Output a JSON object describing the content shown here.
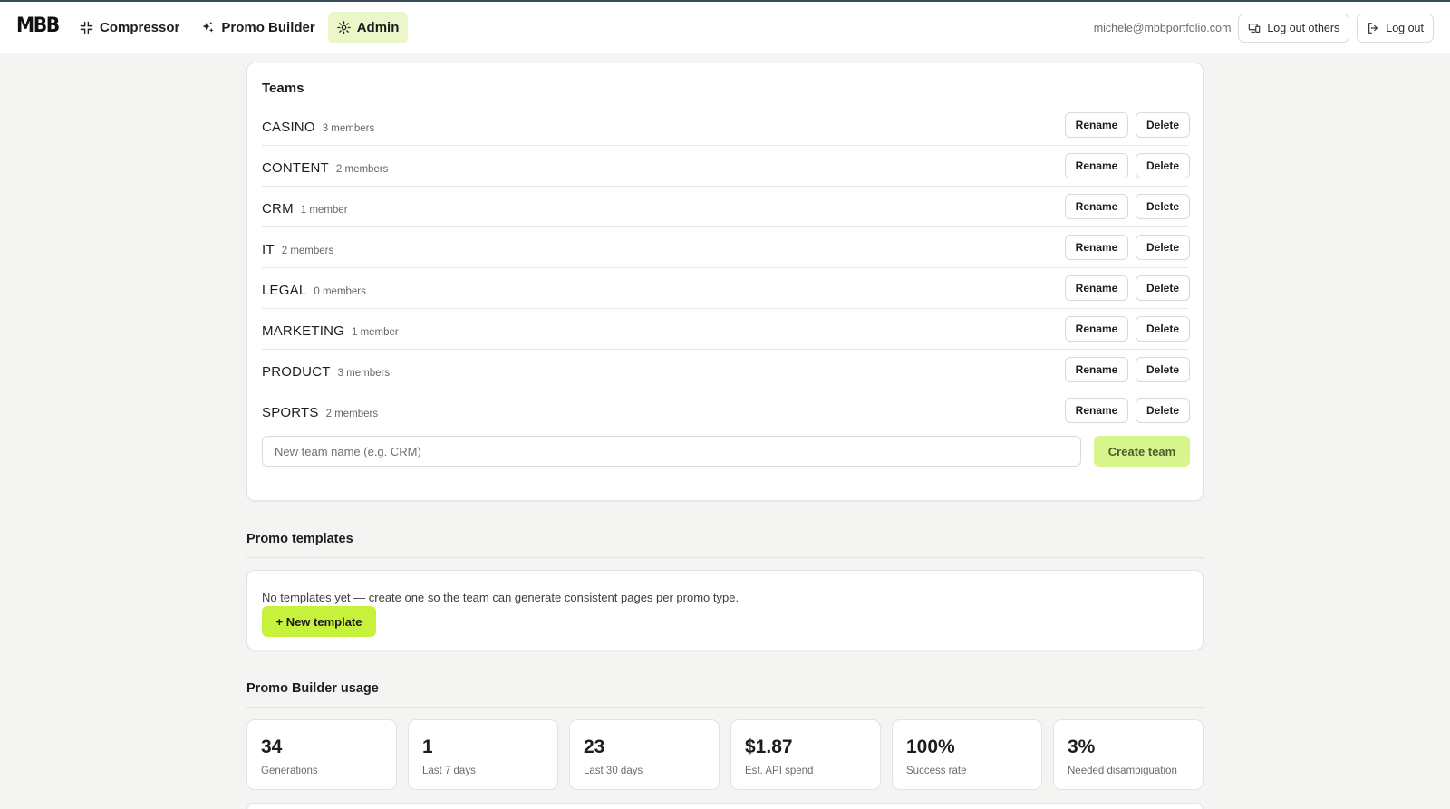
{
  "header": {
    "logo": "MBB",
    "nav": [
      {
        "label": "Compressor",
        "icon": "compress-icon"
      },
      {
        "label": "Promo Builder",
        "icon": "sparkles-icon"
      },
      {
        "label": "Admin",
        "icon": "gear-icon",
        "active": true
      }
    ],
    "email": "michele@mbbportfolio.com",
    "logout_others": "Log out others",
    "logout": "Log out"
  },
  "teams": {
    "title": "Teams",
    "rename_label": "Rename",
    "delete_label": "Delete",
    "items": [
      {
        "name": "CASINO",
        "count": "3 members"
      },
      {
        "name": "CONTENT",
        "count": "2 members"
      },
      {
        "name": "CRM",
        "count": "1 member"
      },
      {
        "name": "IT",
        "count": "2 members"
      },
      {
        "name": "LEGAL",
        "count": "0 members"
      },
      {
        "name": "MARKETING",
        "count": "1 member"
      },
      {
        "name": "PRODUCT",
        "count": "3 members"
      },
      {
        "name": "SPORTS",
        "count": "2 members"
      }
    ],
    "new_team_placeholder": "New team name (e.g. CRM)",
    "create_label": "Create team"
  },
  "templates": {
    "title": "Promo templates",
    "empty_text": "No templates yet — create one so the team can generate consistent pages per promo type.",
    "new_label": "+ New template"
  },
  "usage": {
    "title": "Promo Builder usage",
    "stats": [
      {
        "value": "34",
        "label": "Generations"
      },
      {
        "value": "1",
        "label": "Last 7 days"
      },
      {
        "value": "23",
        "label": "Last 30 days"
      },
      {
        "value": "$1.87",
        "label": "Est. API spend"
      },
      {
        "value": "100%",
        "label": "Success rate"
      },
      {
        "value": "3%",
        "label": "Needed disambiguation"
      }
    ]
  },
  "colors": {
    "accent": "#c6f23c",
    "accent_soft": "#d6f58a",
    "active_nav": "#ecf7c9",
    "background": "#f4f4f3"
  }
}
